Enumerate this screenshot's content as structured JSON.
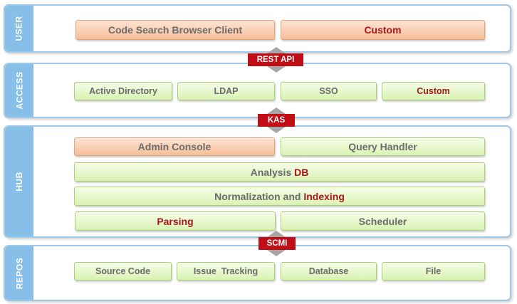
{
  "layers": {
    "user": {
      "label": "USER",
      "items": [
        "Code Search Browser Client",
        "Custom"
      ]
    },
    "access": {
      "label": "ACCESS",
      "items": [
        "Active Directory",
        "LDAP",
        "SSO",
        "Custom"
      ]
    },
    "hub": {
      "label": "HUB",
      "admin_console": "Admin Console",
      "query_handler": "Query Handler",
      "analysis": {
        "prefix": "Analysis",
        "highlight": "DB"
      },
      "normalization": {
        "prefix": "Normalization and",
        "highlight": "Indexing"
      },
      "parsing": "Parsing",
      "scheduler": "Scheduler"
    },
    "repos": {
      "label": "REPOS",
      "items": [
        "Source Code",
        "Issue  Tracking",
        "Database",
        "File"
      ]
    }
  },
  "connectors": {
    "rest_api": "REST API",
    "kas": "KAS",
    "scmi": "SCMI"
  },
  "colors": {
    "layer_tab": "#86bfe8",
    "layer_border": "#9fc8e6",
    "green_box": "#d9f2b3",
    "orange_box": "#f6bf98",
    "highlight_text": "#a8161d",
    "connector_tag": "#c00d16",
    "arrow": "#a6a6a6"
  }
}
